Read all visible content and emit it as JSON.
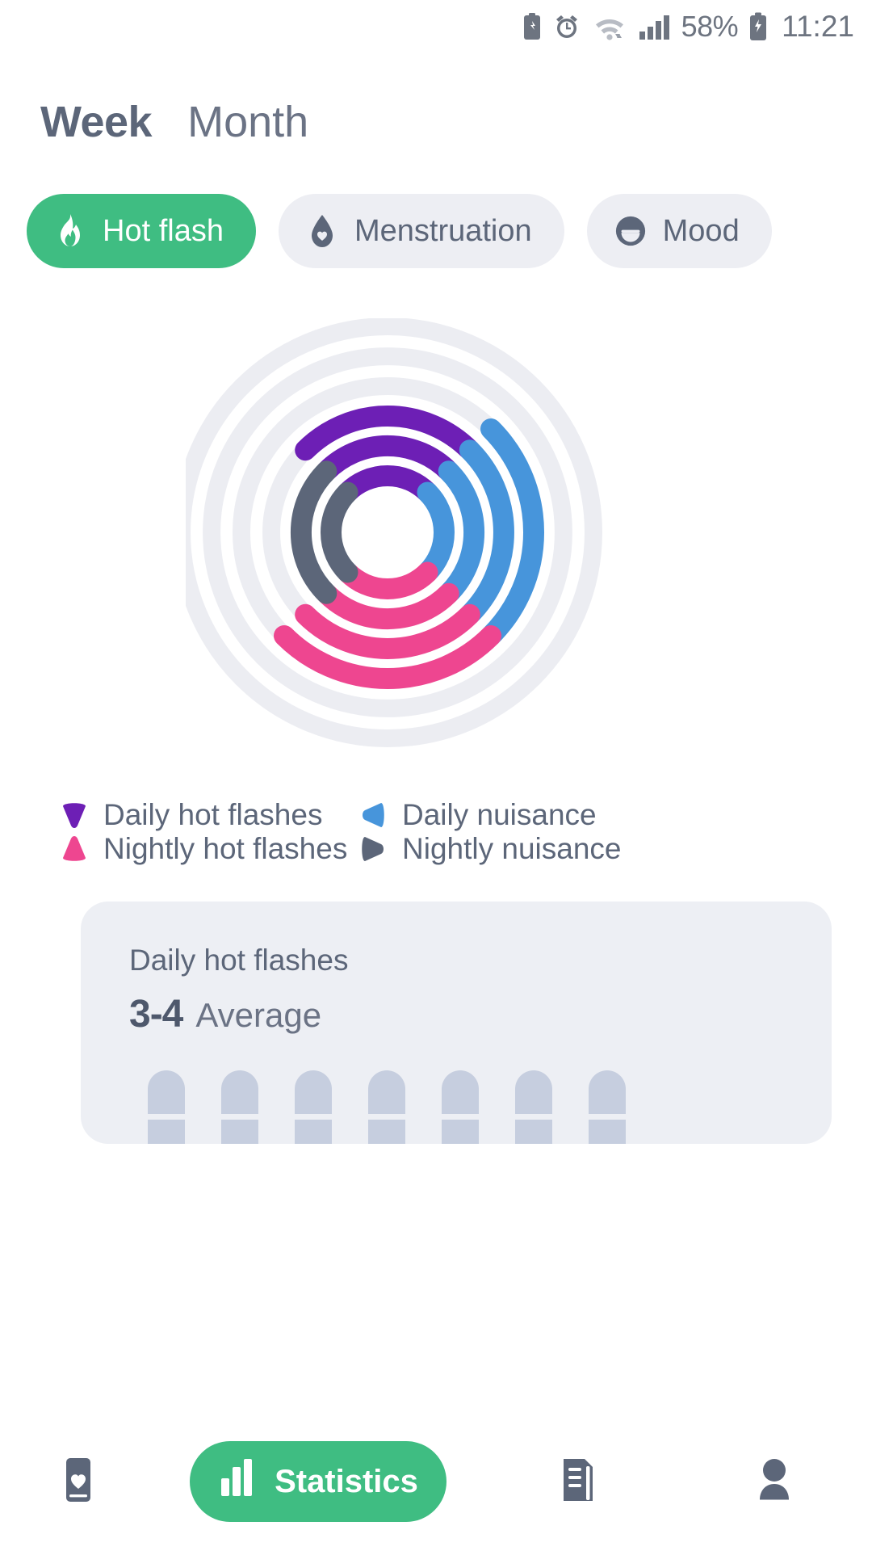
{
  "statusbar": {
    "icons": [
      "battery-saver-icon",
      "alarm-icon",
      "wifi-icon",
      "signal-icon"
    ],
    "battery_percent": "58%",
    "battery_icon": "charging-battery-icon",
    "time": "11:21"
  },
  "period_tabs": [
    {
      "label": "Week",
      "active": true
    },
    {
      "label": "Month",
      "active": false
    }
  ],
  "category_chips": [
    {
      "label": "Hot flash",
      "icon": "flame-icon",
      "active": true
    },
    {
      "label": "Menstruation",
      "icon": "droplet-heart-icon",
      "active": false
    },
    {
      "label": "Mood",
      "icon": "mood-face-icon",
      "active": false
    }
  ],
  "legend": [
    {
      "label": "Daily hot flashes",
      "color": "#6d1fb5",
      "shape": "wedge-down"
    },
    {
      "label": "Daily nuisance",
      "color": "#4795db",
      "shape": "wedge-left"
    },
    {
      "label": "Nightly hot flashes",
      "color": "#ee4690",
      "shape": "wedge-up"
    },
    {
      "label": "Nightly nuisance",
      "color": "#5c6679",
      "shape": "wedge-right"
    }
  ],
  "stat_card": {
    "title": "Daily hot flashes",
    "value": "3-4",
    "value_suffix": "Average",
    "bar_segments": 4,
    "bars": [
      {
        "highlighted": []
      },
      {
        "highlighted": [
          3
        ]
      },
      {
        "highlighted": []
      },
      {
        "highlighted": [
          3
        ]
      },
      {
        "highlighted": []
      },
      {
        "highlighted": []
      },
      {
        "highlighted": []
      }
    ]
  },
  "bottom_nav": [
    {
      "label": "",
      "icon": "diary-heart-icon",
      "active": false
    },
    {
      "label": "Statistics",
      "icon": "bar-chart-icon",
      "active": true
    },
    {
      "label": "",
      "icon": "notes-icon",
      "active": false
    },
    {
      "label": "",
      "icon": "profile-icon",
      "active": false
    }
  ],
  "colors": {
    "accent_green": "#3fbd82",
    "purple": "#6d1fb5",
    "blue": "#4795db",
    "pink": "#ee4690",
    "slate": "#5c6679",
    "track": "#ecedf2",
    "card_bg": "#edeff4",
    "bar_gray": "#c6cedf",
    "bar_orange": "#fca93f"
  },
  "chart_data": {
    "type": "radial-arc",
    "title": "Hot flash weekly radial summary",
    "center": {
      "x": 440,
      "y": 660
    },
    "background_rings": 7,
    "ring_radii": [
      70,
      107,
      144,
      181,
      218,
      255,
      292
    ],
    "series": [
      {
        "name": "Daily hot flashes",
        "color": "#6d1fb5",
        "quadrant": "top",
        "arcs": 3,
        "value": 3
      },
      {
        "name": "Daily nuisance",
        "color": "#4795db",
        "quadrant": "right",
        "arcs": 4,
        "value": 4
      },
      {
        "name": "Nightly hot flashes",
        "color": "#ee4690",
        "quadrant": "bottom",
        "arcs": 4,
        "value": 4
      },
      {
        "name": "Nightly nuisance",
        "color": "#5c6679",
        "quadrant": "left",
        "arcs": 2,
        "value": 2
      }
    ],
    "legend_position": "below"
  }
}
